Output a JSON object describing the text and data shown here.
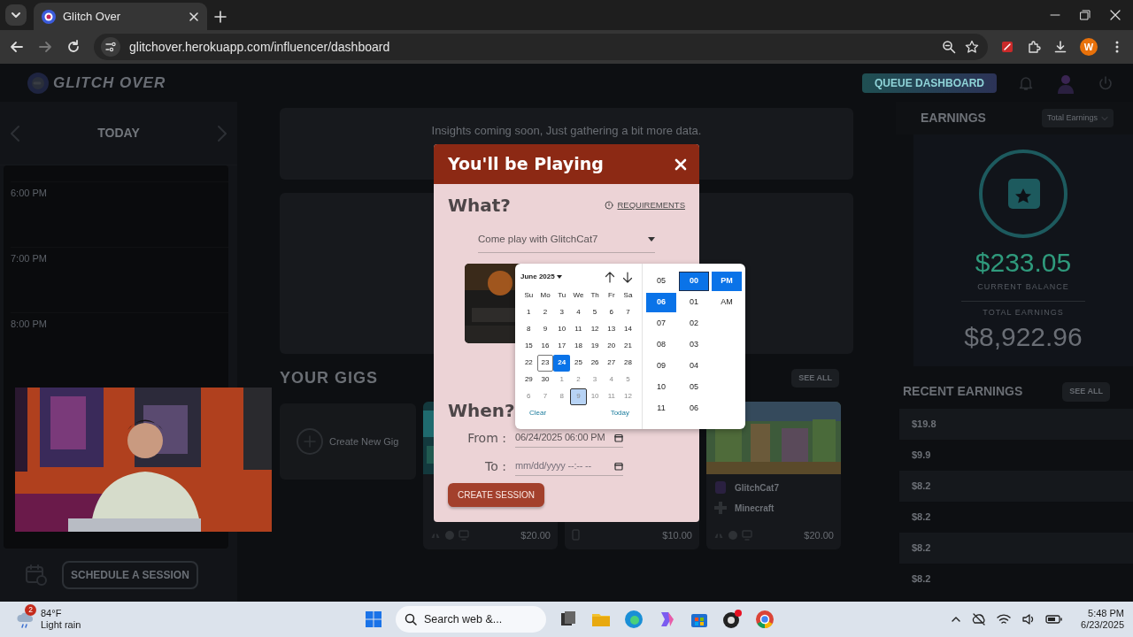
{
  "browser": {
    "tabs": [
      {
        "title": "Glitch Over",
        "selected": true
      }
    ],
    "forward_disabled": true,
    "url": "glitchover.herokuapp.com/influencer/dashboard",
    "profile_initial": "W"
  },
  "header": {
    "logo": "GLITCH OVER",
    "queue_button": "QUEUE DASHBOARD"
  },
  "schedule": {
    "title": "TODAY",
    "time_labels": [
      "6:00 PM",
      "7:00 PM",
      "8:00 PM"
    ],
    "button": "SCHEDULE A SESSION"
  },
  "insights": {
    "text": "Insights coming soon, Just gathering a bit more data."
  },
  "gigs": {
    "title": "YOUR GIGS",
    "see_all": "SEE ALL",
    "create": "Create New Gig",
    "cards": [
      {
        "kind": "console",
        "price": "$20.00"
      },
      {
        "kind": "mobile",
        "price": "$10.00"
      },
      {
        "kind": "console",
        "price": "$20.00",
        "streamer": "GlitchCat7",
        "game": "Minecraft"
      }
    ]
  },
  "earnings": {
    "title": "EARNINGS",
    "filter": "Total Earnings",
    "balance": "$233.05",
    "balance_label": "CURRENT BALANCE",
    "total_label": "TOTAL EARNINGS",
    "total": "$8,922.96",
    "recent_title": "RECENT EARNINGS",
    "see_all": "SEE ALL",
    "recent": [
      {
        "amount": "$19.8"
      },
      {
        "amount": "$9.9"
      },
      {
        "amount": "$8.2"
      },
      {
        "amount": "$8.2"
      },
      {
        "amount": "$8.2"
      },
      {
        "amount": "$8.2"
      }
    ]
  },
  "modal": {
    "title": "You'll be Playing",
    "what": "What?",
    "requirements": "REQUIREMENTS",
    "session_select": "Come play with GlitchCat7",
    "when": "When?",
    "from_label": "From :",
    "from_value": "06/24/2025 06:00 PM",
    "to_label": "To :",
    "to_placeholder": "mm/dd/yyyy --:-- --",
    "submit": "CREATE SESSION"
  },
  "datepicker": {
    "month": "June 2025",
    "weekdays": [
      "Su",
      "Mo",
      "Tu",
      "We",
      "Th",
      "Fr",
      "Sa"
    ],
    "days": [
      {
        "label": "1",
        "muted": false,
        "selected": false,
        "today": false,
        "hovered": false
      },
      {
        "label": "2",
        "muted": false,
        "selected": false,
        "today": false,
        "hovered": false
      },
      {
        "label": "3",
        "muted": false,
        "selected": false,
        "today": false,
        "hovered": false
      },
      {
        "label": "4",
        "muted": false,
        "selected": false,
        "today": false,
        "hovered": false
      },
      {
        "label": "5",
        "muted": false,
        "selected": false,
        "today": false,
        "hovered": false
      },
      {
        "label": "6",
        "muted": false,
        "selected": false,
        "today": false,
        "hovered": false
      },
      {
        "label": "7",
        "muted": false,
        "selected": false,
        "today": false,
        "hovered": false
      },
      {
        "label": "8",
        "muted": false,
        "selected": false,
        "today": false,
        "hovered": false
      },
      {
        "label": "9",
        "muted": false,
        "selected": false,
        "today": false,
        "hovered": false
      },
      {
        "label": "10",
        "muted": false,
        "selected": false,
        "today": false,
        "hovered": false
      },
      {
        "label": "11",
        "muted": false,
        "selected": false,
        "today": false,
        "hovered": false
      },
      {
        "label": "12",
        "muted": false,
        "selected": false,
        "today": false,
        "hovered": false
      },
      {
        "label": "13",
        "muted": false,
        "selected": false,
        "today": false,
        "hovered": false
      },
      {
        "label": "14",
        "muted": false,
        "selected": false,
        "today": false,
        "hovered": false
      },
      {
        "label": "15",
        "muted": false,
        "selected": false,
        "today": false,
        "hovered": false
      },
      {
        "label": "16",
        "muted": false,
        "selected": false,
        "today": false,
        "hovered": false
      },
      {
        "label": "17",
        "muted": false,
        "selected": false,
        "today": false,
        "hovered": false
      },
      {
        "label": "18",
        "muted": false,
        "selected": false,
        "today": false,
        "hovered": false
      },
      {
        "label": "19",
        "muted": false,
        "selected": false,
        "today": false,
        "hovered": false
      },
      {
        "label": "20",
        "muted": false,
        "selected": false,
        "today": false,
        "hovered": false
      },
      {
        "label": "21",
        "muted": false,
        "selected": false,
        "today": false,
        "hovered": false
      },
      {
        "label": "22",
        "muted": false,
        "selected": false,
        "today": false,
        "hovered": false
      },
      {
        "label": "23",
        "muted": false,
        "selected": false,
        "today": true,
        "hovered": false
      },
      {
        "label": "24",
        "muted": false,
        "selected": true,
        "today": false,
        "hovered": false
      },
      {
        "label": "25",
        "muted": false,
        "selected": false,
        "today": false,
        "hovered": false
      },
      {
        "label": "26",
        "muted": false,
        "selected": false,
        "today": false,
        "hovered": false
      },
      {
        "label": "27",
        "muted": false,
        "selected": false,
        "today": false,
        "hovered": false
      },
      {
        "label": "28",
        "muted": false,
        "selected": false,
        "today": false,
        "hovered": false
      },
      {
        "label": "29",
        "muted": false,
        "selected": false,
        "today": false,
        "hovered": false
      },
      {
        "label": "30",
        "muted": false,
        "selected": false,
        "today": false,
        "hovered": false
      },
      {
        "label": "1",
        "muted": true,
        "selected": false,
        "today": false,
        "hovered": false
      },
      {
        "label": "2",
        "muted": true,
        "selected": false,
        "today": false,
        "hovered": false
      },
      {
        "label": "3",
        "muted": true,
        "selected": false,
        "today": false,
        "hovered": false
      },
      {
        "label": "4",
        "muted": true,
        "selected": false,
        "today": false,
        "hovered": false
      },
      {
        "label": "5",
        "muted": true,
        "selected": false,
        "today": false,
        "hovered": false
      },
      {
        "label": "6",
        "muted": true,
        "selected": false,
        "today": false,
        "hovered": false
      },
      {
        "label": "7",
        "muted": true,
        "selected": false,
        "today": false,
        "hovered": false
      },
      {
        "label": "8",
        "muted": true,
        "selected": false,
        "today": false,
        "hovered": false
      },
      {
        "label": "9",
        "muted": true,
        "selected": false,
        "today": false,
        "hovered": true
      },
      {
        "label": "10",
        "muted": true,
        "selected": false,
        "today": false,
        "hovered": false
      },
      {
        "label": "11",
        "muted": true,
        "selected": false,
        "today": false,
        "hovered": false
      },
      {
        "label": "12",
        "muted": true,
        "selected": false,
        "today": false,
        "hovered": false
      }
    ],
    "hours": [
      {
        "label": "05",
        "selected": false
      },
      {
        "label": "06",
        "selected": true
      },
      {
        "label": "07",
        "selected": false
      },
      {
        "label": "08",
        "selected": false
      },
      {
        "label": "09",
        "selected": false
      },
      {
        "label": "10",
        "selected": false
      },
      {
        "label": "11",
        "selected": false
      }
    ],
    "minutes": [
      {
        "label": "00",
        "selected": true
      },
      {
        "label": "01",
        "selected": false
      },
      {
        "label": "02",
        "selected": false
      },
      {
        "label": "03",
        "selected": false
      },
      {
        "label": "04",
        "selected": false
      },
      {
        "label": "05",
        "selected": false
      },
      {
        "label": "06",
        "selected": false
      }
    ],
    "meridiem": [
      {
        "label": "PM",
        "selected": true
      },
      {
        "label": "AM",
        "selected": false
      }
    ],
    "clear": "Clear",
    "today": "Today"
  },
  "taskbar": {
    "weather_badge": "2",
    "temperature": "84°F",
    "condition": "Light rain",
    "search_placeholder": "Search web &...",
    "time": "5:48 PM",
    "date": "6/23/2025"
  }
}
